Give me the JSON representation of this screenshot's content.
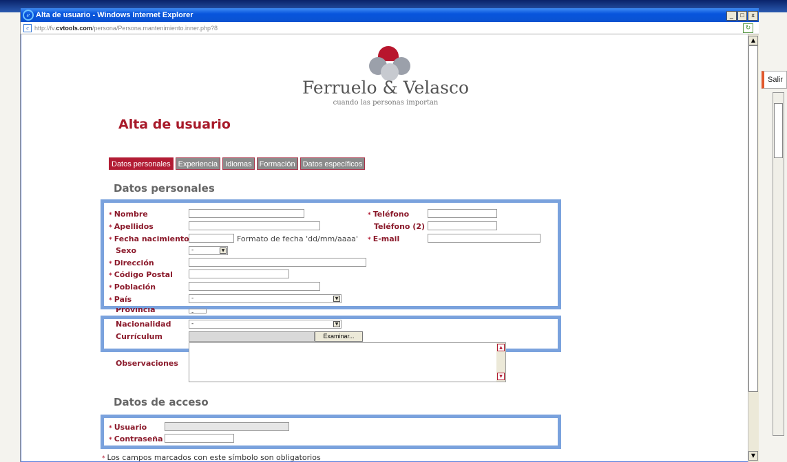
{
  "window": {
    "title": "Alta de usuario - Windows Internet Explorer",
    "controls": [
      "_",
      "□",
      "x"
    ],
    "address_prefix": "http://fv.",
    "address_domain": "cvtools.com",
    "address_path": "/persona/Persona.mantenimiento.inner.php?8"
  },
  "background_window": {
    "salir_label": "Salir"
  },
  "brand": {
    "name": "Ferruelo & Velasco",
    "tagline": "cuando las personas importan",
    "colors": {
      "accent": "#b21c34",
      "grey": "#9ba0aa"
    }
  },
  "page_title": "Alta de usuario",
  "tabs": [
    {
      "label": "Datos personales",
      "active": true
    },
    {
      "label": "Experiencia",
      "active": false
    },
    {
      "label": "Idiomas",
      "active": false
    },
    {
      "label": "Formación",
      "active": false
    },
    {
      "label": "Datos específicos",
      "active": false
    }
  ],
  "section_personal": "Datos personales",
  "required_mark": "*",
  "fields": {
    "nombre": "Nombre",
    "apellidos": "Apellidos",
    "fecha_nacimiento": "Fecha nacimiento",
    "fecha_hint": "Formato de fecha 'dd/mm/aaaa'",
    "sexo": "Sexo",
    "sexo_value": "-",
    "direccion": "Dirección",
    "codigo_postal": "Código Postal",
    "poblacion": "Población",
    "pais": "País",
    "pais_value": "-",
    "provincia": "Provincia",
    "provincia_value": "-",
    "nacionalidad": "Nacionalidad",
    "nacionalidad_value": "-",
    "curriculum": "Currículum",
    "examinar": "Examinar...",
    "observaciones": "Observaciones",
    "telefono": "Teléfono",
    "telefono2": "Teléfono (2)",
    "email": "E-mail"
  },
  "section_access": "Datos de acceso",
  "access": {
    "usuario": "Usuario",
    "contrasena": "Contraseña"
  },
  "footnote": "Los campos marcados con este símbolo son obligatorios"
}
